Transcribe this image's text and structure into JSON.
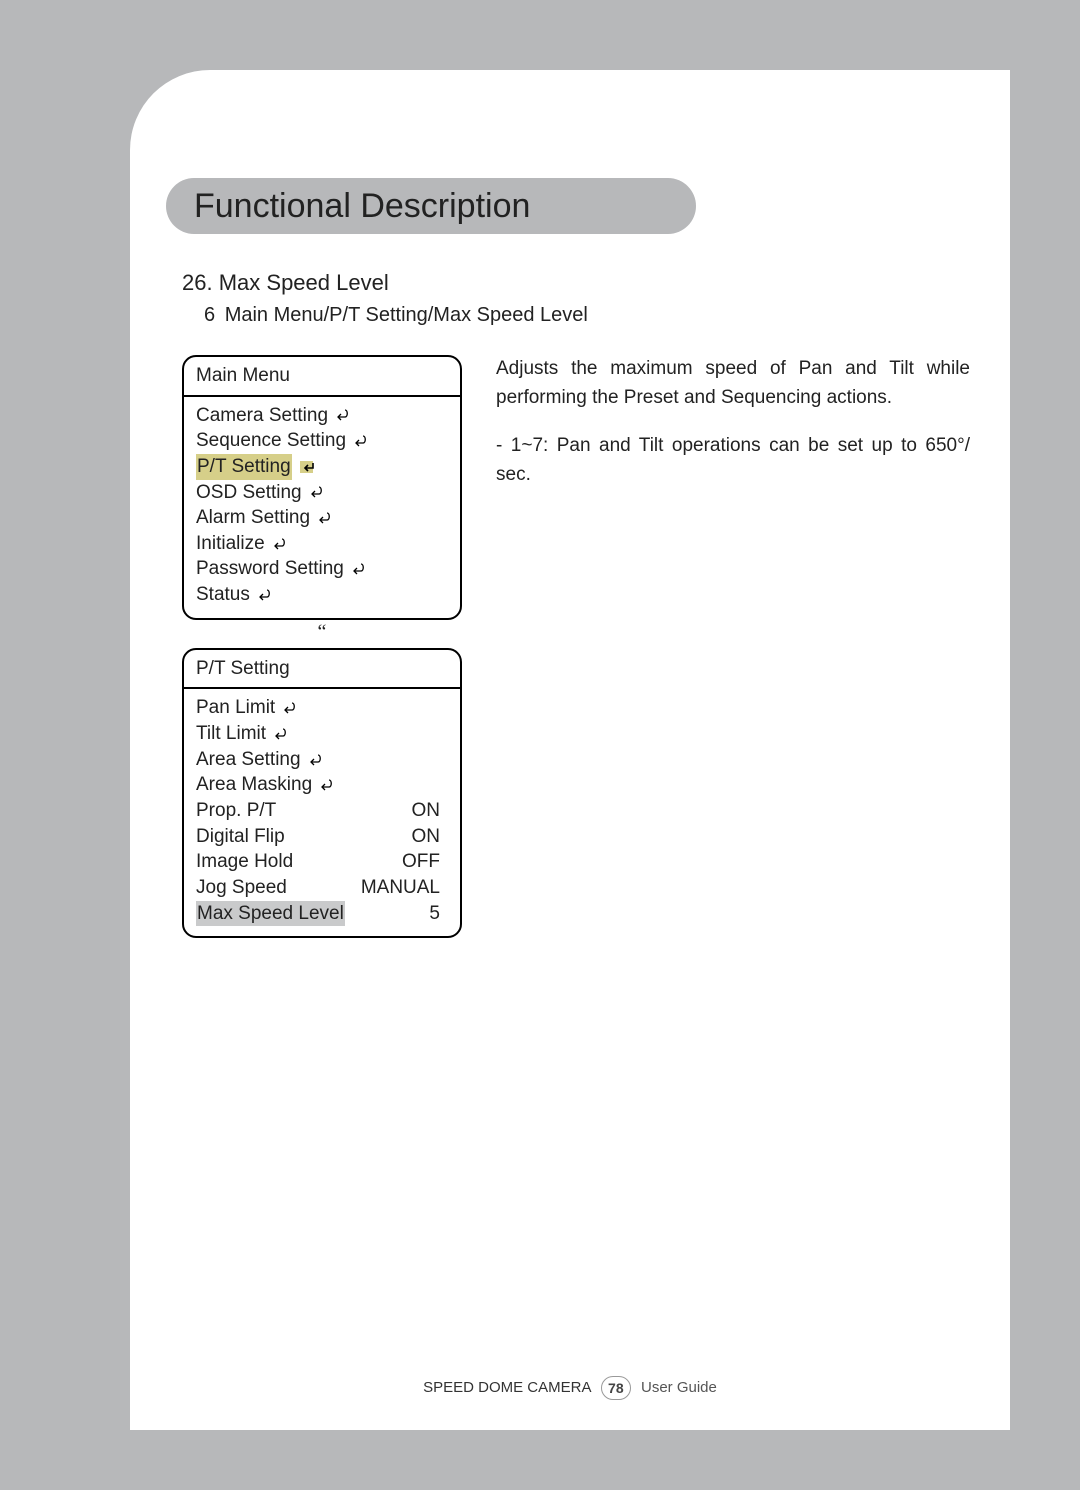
{
  "header": {
    "title": "Functional Description"
  },
  "section": {
    "number": "26.",
    "title": "Max Speed Level",
    "breadcrumb_num": "6",
    "breadcrumb": "Main Menu/P/T Setting/Max Speed Level"
  },
  "main_menu": {
    "title": "Main Menu",
    "items": [
      {
        "label": "Camera Setting",
        "has_cursor": true
      },
      {
        "label": "Sequence Setting",
        "has_cursor": true
      },
      {
        "label": "P/T Setting",
        "has_cursor": true,
        "highlight": "yellow",
        "enter_icon": true
      },
      {
        "label": "OSD Setting",
        "has_cursor": true
      },
      {
        "label": "Alarm Setting",
        "has_cursor": true
      },
      {
        "label": "Initialize",
        "has_cursor": true
      },
      {
        "label": "Password Setting",
        "has_cursor": true
      },
      {
        "label": "Status",
        "has_cursor": true
      }
    ]
  },
  "divider_glyph": "“",
  "pt_menu": {
    "title": "P/T Setting",
    "items": [
      {
        "label": "Pan Limit",
        "has_cursor": true
      },
      {
        "label": "Tilt Limit",
        "has_cursor": true
      },
      {
        "label": "Area Setting",
        "has_cursor": true
      },
      {
        "label": "Area Masking",
        "has_cursor": true
      },
      {
        "label": "Prop. P/T",
        "value": "ON"
      },
      {
        "label": "Digital Flip",
        "value": "ON"
      },
      {
        "label": "Image Hold",
        "value": "OFF"
      },
      {
        "label": "Jog Speed",
        "value": "MANUAL"
      },
      {
        "label": "Max Speed Level",
        "value": "5",
        "highlight": "grey"
      }
    ]
  },
  "description": {
    "para1": "Adjusts the maximum speed of Pan and Tilt while performing the Preset and Sequencing actions.",
    "bullet1": "- 1~7: Pan and Tilt operations can be set up to  650°/ sec."
  },
  "footer": {
    "left": "SPEED DOME CAMERA",
    "page": "78",
    "right": "User Guide"
  }
}
